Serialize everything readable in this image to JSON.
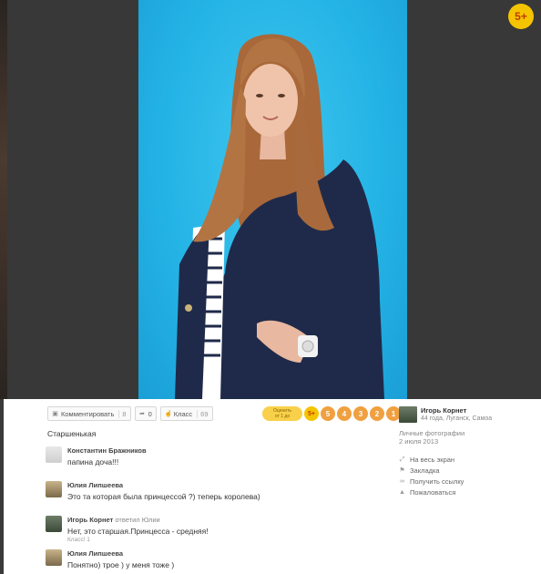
{
  "age_badge": "5+",
  "actions": {
    "comment_label": "Комментировать",
    "comment_count": "8",
    "share_count": "0",
    "like_label": "Класс",
    "like_count": "69"
  },
  "rating": {
    "label_line1": "Оценить",
    "label_line2": "от 1 до",
    "stars": [
      "5+",
      "5",
      "4",
      "3",
      "2",
      "1"
    ]
  },
  "caption": "Старшенькая",
  "comments": [
    {
      "author": "Константин Бражников",
      "reply_text": "",
      "text": "папина доча!!!",
      "like": ""
    },
    {
      "author": "Юлия Липшеева",
      "reply_text": "",
      "text": "Это та которая была принцессой ?) теперь королева)",
      "like": ""
    },
    {
      "author": "Игорь Корнет",
      "reply_text": "ответил Юлии",
      "text": "Нет, это старшая.Принцесса - средняя!",
      "like": "Класс! 1"
    },
    {
      "author": "Юлия Липшеева",
      "reply_text": "",
      "text": "Понятно) трое ) у меня тоже )",
      "like": ""
    }
  ],
  "owner": {
    "name": "Игорь Корнет",
    "info": "44 года, Луганск, Самоа",
    "album": "Личные фотографии",
    "date": "2 июля 2013"
  },
  "menu": [
    {
      "icon": "fullscreen-icon",
      "label": "На весь экран"
    },
    {
      "icon": "bookmark-icon",
      "label": "Закладка"
    },
    {
      "icon": "link-icon",
      "label": "Получить ссылку"
    },
    {
      "icon": "warning-icon",
      "label": "Пожаловаться"
    }
  ],
  "colors": {
    "photo_bg": "#25b4e6",
    "rating_yellow": "#f5c400",
    "star_orange": "#f0a040"
  }
}
